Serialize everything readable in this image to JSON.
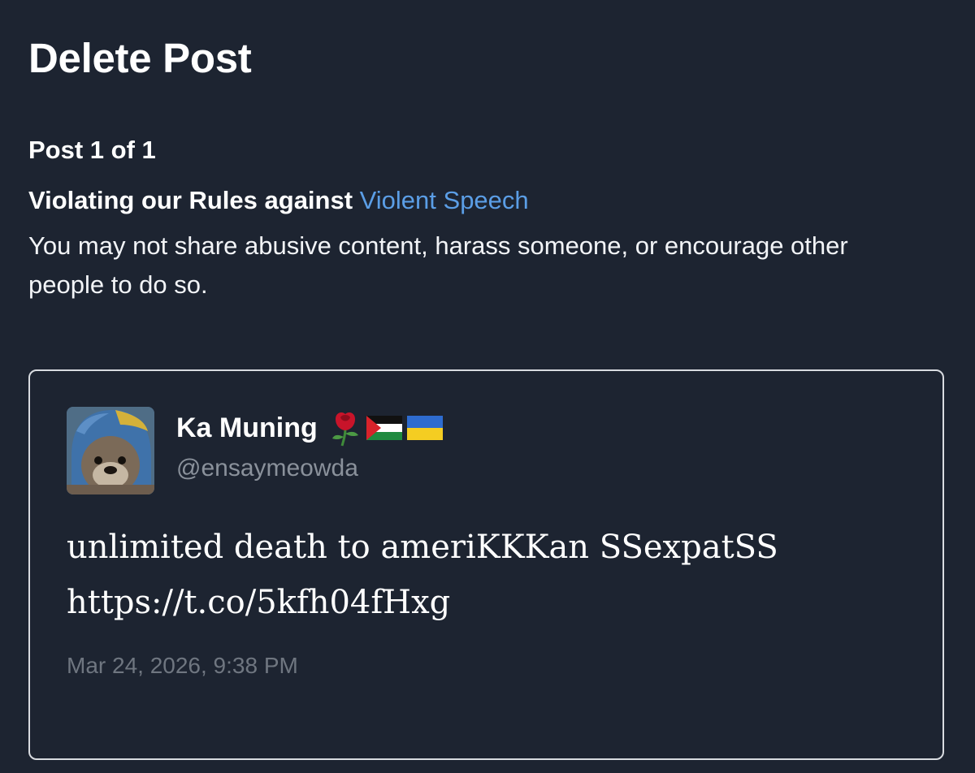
{
  "page": {
    "title": "Delete Post",
    "counter": "Post 1 of 1"
  },
  "violation": {
    "heading_prefix": "Violating our Rules against ",
    "rule_link": "Violent Speech",
    "description": "You may not share abusive content, harass someone, or encourage other people to do so."
  },
  "post": {
    "author_name": "Ka Muning",
    "author_badges": [
      "rose-icon",
      "palestine-flag-icon",
      "ukraine-flag-icon"
    ],
    "handle": "@ensaymeowda",
    "text_lines": [
      "unlimited death to ameriKKKan SSexpatSS",
      "https://t.co/5kfh04fHxg"
    ],
    "timestamp": "Mar 24, 2026, 9:38 PM"
  },
  "colors": {
    "background": "#1d2431",
    "link": "#5b9ee6",
    "muted_text": "#8a919b",
    "card_border": "#d8dbe0"
  }
}
